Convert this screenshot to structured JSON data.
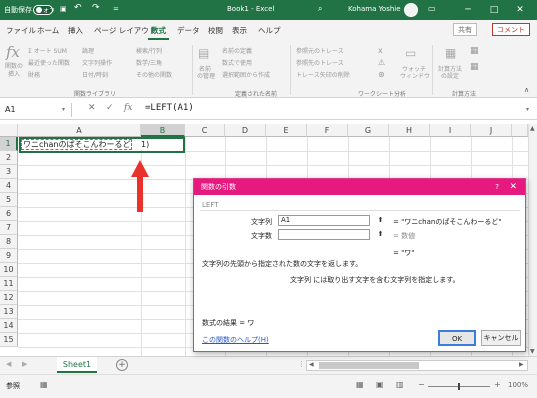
{
  "titlebar": {
    "autosave_label": "自動保存",
    "autosave_state": "オフ",
    "undo": "↶",
    "redo": "↷",
    "customize": "=",
    "title": "Book1 - Excel",
    "search_icon": "search-icon",
    "user": "Kohama Yoshie",
    "min": "─",
    "max": "□",
    "close": "✕"
  },
  "tabs": [
    "ファイル",
    "ホーム",
    "挿入",
    "ページ レイアウト",
    "数式",
    "データ",
    "校閲",
    "表示",
    "ヘルプ"
  ],
  "active_tab": "数式",
  "share_label": "共有",
  "comment_label": "コメント",
  "ribbon": {
    "insert_func_1": "関数の",
    "insert_func_2": "挿入",
    "autosum": "Σ オート SUM",
    "recent": "最近使った関数",
    "finance": "財務",
    "logical": "論理",
    "text": "文字列操作",
    "datetime": "日付/時刻",
    "lookup": "検索/行列",
    "math": "数学/三角",
    "more": "その他の関数",
    "group1": "関数ライブラリ",
    "name_manager_1": "名前",
    "name_manager_2": "の管理",
    "define_name": "名前の定義",
    "use_in_formula": "数式で使用",
    "create_from_sel": "選択範囲から作成",
    "group2": "定義された名前",
    "trace_prec": "参照元のトレース",
    "trace_dep": "参照先のトレース",
    "remove_arrows": "トレース矢印の削除",
    "watch_1": "ウォッチ",
    "watch_2": "ウィンドウ",
    "group3": "ワークシート分析",
    "calc_opt_1": "計算方法",
    "calc_opt_2": "の設定",
    "group4": "計算方法"
  },
  "formula_bar": {
    "name_box": "A1",
    "cancel": "✕",
    "enter": "✓",
    "fx": "fx",
    "formula": "=LEFT(A1)"
  },
  "grid": {
    "columns": [
      "A",
      "B",
      "C",
      "D",
      "E",
      "F",
      "G",
      "H",
      "I",
      "J"
    ],
    "selected_column": "B",
    "rows": [
      "1",
      "2",
      "3",
      "4",
      "5",
      "6",
      "7",
      "8",
      "9",
      "10",
      "11",
      "12",
      "13",
      "14",
      "15"
    ],
    "selected_row": "1",
    "a1_text": "ワニchanのぱそこんわーるど",
    "b1_text": "1)"
  },
  "dialog": {
    "title": "関数の引数",
    "help": "?",
    "close": "✕",
    "function_name": "LEFT",
    "arg1_label": "文字列",
    "arg1_value": "A1",
    "arg1_result": "=  \"ワニchanのぱそこんわーるど\"",
    "arg2_label": "文字数",
    "arg2_value": "",
    "arg2_result": "=  数値",
    "result_line": "=  \"ワ\"",
    "description": "文字列の先頭から指定された数の文字を返します。",
    "arg_description": "文字列  には取り出す文字を含む文字列を指定します。",
    "formula_result": "数式の結果 =  ワ",
    "help_link": "この関数のヘルプ(H)",
    "ok": "OK",
    "cancel": "キャンセル"
  },
  "sheet": {
    "name": "Sheet1",
    "add": "+"
  },
  "statusbar": {
    "mode": "参照",
    "zoom": "100%"
  },
  "colors": {
    "excel_green": "#217346",
    "dialog_accent": "#e6197f",
    "arrow_red": "#e8322b"
  }
}
